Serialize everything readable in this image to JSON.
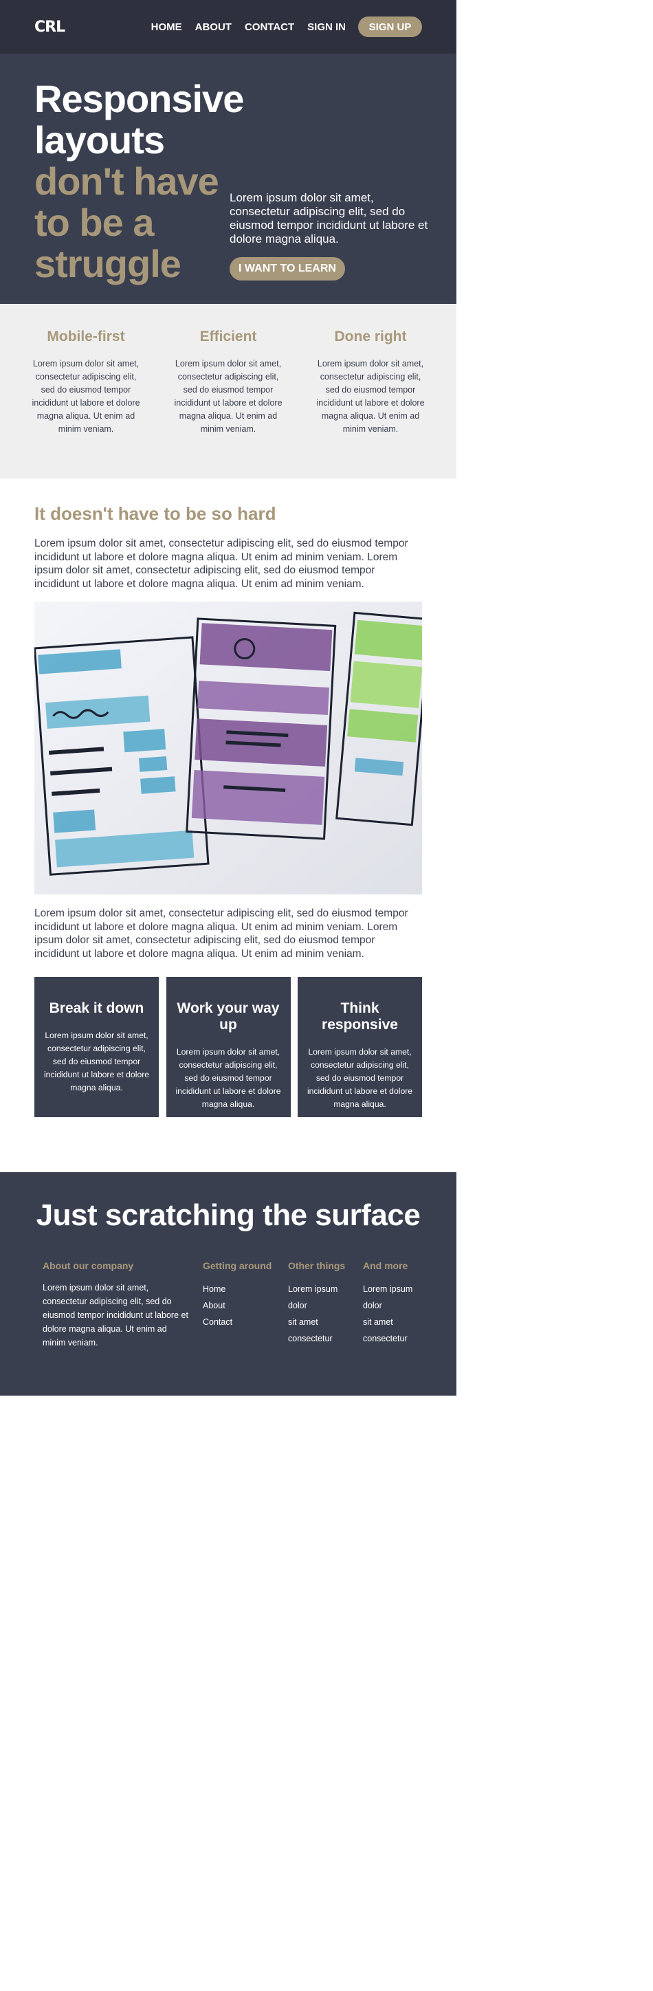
{
  "nav": {
    "logo": "CRL",
    "links": [
      "HOME",
      "ABOUT",
      "CONTACT",
      "SIGN IN"
    ],
    "cta": "SIGN UP"
  },
  "hero": {
    "title_light_1": "Responsive",
    "title_light_2": "layouts",
    "title_gold_1": "don't have",
    "title_gold_2": "to be a",
    "title_gold_3": "struggle",
    "text": "Lorem ipsum dolor sit amet, consectetur adipiscing elit, sed do eiusmod tempor incididunt ut labore et dolore magna aliqua.",
    "button": "I WANT TO LEARN"
  },
  "features": [
    {
      "title": "Mobile-first",
      "text": "Lorem ipsum dolor sit amet, consectetur adipiscing elit, sed do eiusmod tempor incididunt ut labore et dolore magna aliqua. Ut enim ad minim veniam."
    },
    {
      "title": "Efficient",
      "text": "Lorem ipsum dolor sit amet, consectetur adipiscing elit, sed do eiusmod tempor incididunt ut labore et dolore magna aliqua. Ut enim ad minim veniam."
    },
    {
      "title": "Done right",
      "text": "Lorem ipsum dolor sit amet, consectetur adipiscing elit, sed do eiusmod tempor incididunt ut labore et dolore magna aliqua. Ut enim ad minim veniam."
    }
  ],
  "main": {
    "heading": "It doesn't have to be so hard",
    "para1": "Lorem ipsum dolor sit amet, consectetur adipiscing elit, sed do eiusmod tempor incididunt ut labore et dolore magna aliqua. Ut enim ad minim veniam. Lorem ipsum dolor sit amet, consectetur adipiscing elit, sed do eiusmod tempor incididunt ut labore et dolore magna aliqua. Ut enim ad minim veniam.",
    "para2": "Lorem ipsum dolor sit amet, consectetur adipiscing elit, sed do eiusmod tempor incididunt ut labore et dolore magna aliqua. Ut enim ad minim veniam. Lorem ipsum dolor sit amet, consectetur adipiscing elit, sed do eiusmod tempor incididunt ut labore et dolore magna aliqua. Ut enim ad minim veniam."
  },
  "cards": [
    {
      "title": "Break it down",
      "text": "Lorem ipsum dolor sit amet, consectetur adipiscing elit, sed do eiusmod tempor incididunt ut labore et dolore magna aliqua."
    },
    {
      "title": "Work your way up",
      "text": "Lorem ipsum dolor sit amet, consectetur adipiscing elit, sed do eiusmod tempor incididunt ut labore et dolore magna aliqua."
    },
    {
      "title": "Think responsive",
      "text": "Lorem ipsum dolor sit amet, consectetur adipiscing elit, sed do eiusmod tempor incididunt ut labore et dolore magna aliqua."
    }
  ],
  "footer": {
    "title": "Just scratching the surface",
    "about_title": "About our company",
    "about_text": "Lorem ipsum dolor sit amet, consectetur adipiscing elit, sed do eiusmod tempor incididunt ut labore et dolore magna aliqua. Ut enim ad minim veniam.",
    "getting_title": "Getting around",
    "getting_links": [
      "Home",
      "About",
      "Contact"
    ],
    "other_title": "Other things",
    "other_links": [
      "Lorem ipsum",
      "dolor",
      "sit amet",
      "consectetur"
    ],
    "more_title": "And more",
    "more_links": [
      "Lorem ipsum",
      "dolor",
      "sit amet",
      "consectetur"
    ]
  },
  "colors": {
    "nav_bg": "#2e313d",
    "dark_bg": "#3a3f50",
    "accent": "#a8987a",
    "light_bg": "#efefef"
  }
}
